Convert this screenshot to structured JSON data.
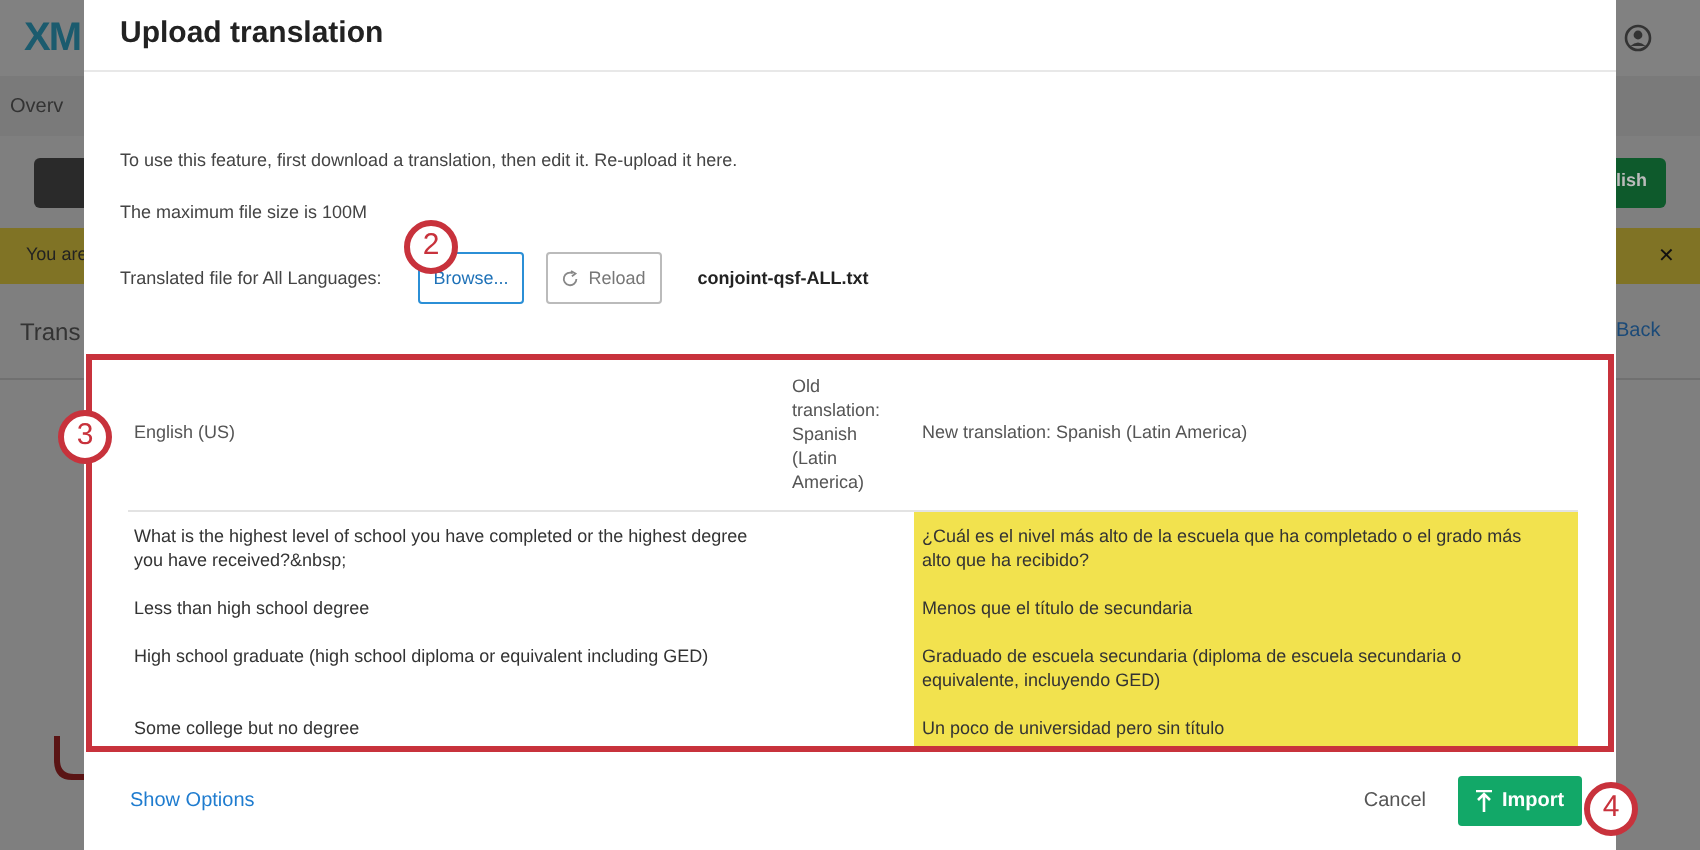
{
  "background_page": {
    "logo": "XM",
    "nav_tab": "Overv",
    "banner": "You are",
    "heading": "Trans",
    "publish_button": "lish",
    "back_link": "Back",
    "banner_close": "✕"
  },
  "dialog": {
    "title": "Upload translation",
    "instructions": [
      "To use this feature, first download a translation, then edit it. Re-upload it here.",
      "The maximum file size is 100M"
    ],
    "file_row": {
      "label": "Translated file for All Languages:",
      "buttons": [
        {
          "label": "Browse...",
          "kind": "primary"
        },
        {
          "label": "Reload",
          "kind": "reload"
        }
      ],
      "file_name": "conjoint-qsf-ALL.txt"
    },
    "table": {
      "columns": [
        "English (US)",
        "Old translation: Spanish (Latin America)",
        "New translation: Spanish (Latin America)"
      ],
      "rows": [
        {
          "source": "What is the highest level of school you have completed or the highest degree you have received?&nbsp;",
          "translation": "¿Cuál es el nivel más alto de la escuela que ha completado o el grado más alto que ha recibido?",
          "changed": true
        },
        {
          "source": "Less than high school degree",
          "translation": "Menos que el título de secundaria",
          "changed": true
        },
        {
          "source": "High school graduate (high school diploma or equivalent including GED)",
          "translation": "Graduado de escuela secundaria (diploma de escuela secundaria o equivalente, incluyendo GED)",
          "changed": true
        },
        {
          "source": "Some college but no degree",
          "translation": "Un poco de universidad pero sin título",
          "changed": true
        }
      ]
    },
    "footer": {
      "link": "Show Options",
      "buttons": [
        {
          "label": "Cancel",
          "kind": "text"
        },
        {
          "label": "Import",
          "kind": "import"
        }
      ]
    }
  },
  "callouts": [
    {
      "label": "2",
      "kind": "browse"
    },
    {
      "label": "3",
      "kind": "table"
    },
    {
      "label": "4",
      "kind": "import"
    }
  ]
}
